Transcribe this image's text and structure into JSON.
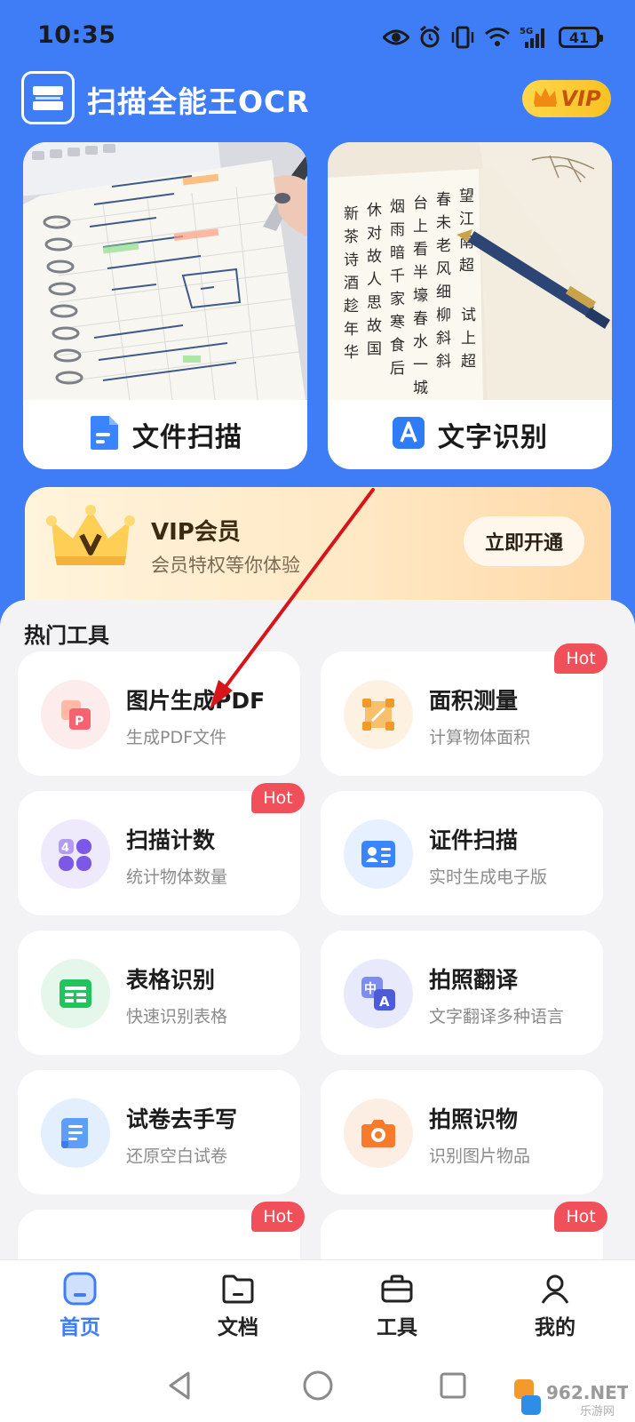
{
  "status_bar": {
    "time": "10:35",
    "battery": "41",
    "network": "5G"
  },
  "app": {
    "title": "扫描全能王OCR",
    "vip_badge": "VIP"
  },
  "feature_cards": [
    {
      "label": "文件扫描",
      "icon": "document-icon"
    },
    {
      "label": "文字识别",
      "icon": "letter-a-icon"
    }
  ],
  "vip_banner": {
    "title": "VIP会员",
    "subtitle": "会员特权等你体验",
    "button": "立即开通"
  },
  "tools": {
    "section_title": "热门工具",
    "hot_label": "Hot",
    "items": [
      {
        "name": "图片生成PDF",
        "desc": "生成PDF文件",
        "icon": "image-to-pdf-icon",
        "hot": false
      },
      {
        "name": "面积测量",
        "desc": "计算物体面积",
        "icon": "area-measure-icon",
        "hot": true
      },
      {
        "name": "扫描计数",
        "desc": "统计物体数量",
        "icon": "count-icon",
        "hot": true
      },
      {
        "name": "证件扫描",
        "desc": "实时生成电子版",
        "icon": "id-card-icon",
        "hot": false
      },
      {
        "name": "表格识别",
        "desc": "快速识别表格",
        "icon": "table-icon",
        "hot": false
      },
      {
        "name": "拍照翻译",
        "desc": "文字翻译多种语言",
        "icon": "translate-icon",
        "hot": false
      },
      {
        "name": "试卷去手写",
        "desc": "还原空白试卷",
        "icon": "paper-scroll-icon",
        "hot": false
      },
      {
        "name": "拍照识物",
        "desc": "识别图片物品",
        "icon": "camera-icon",
        "hot": false
      }
    ]
  },
  "bottom_nav": [
    {
      "label": "首页",
      "icon": "home-icon",
      "active": true
    },
    {
      "label": "文档",
      "icon": "folder-icon",
      "active": false
    },
    {
      "label": "工具",
      "icon": "toolbox-icon",
      "active": false
    },
    {
      "label": "我的",
      "icon": "profile-icon",
      "active": false
    }
  ],
  "watermark": {
    "text": "962.NET",
    "subtext": "乐游网"
  },
  "colors": {
    "brand_blue": "#3f7df7",
    "hot_red": "#f0505a",
    "vip_gold": "#f8c124",
    "annotation_arrow": "#d8141b"
  }
}
